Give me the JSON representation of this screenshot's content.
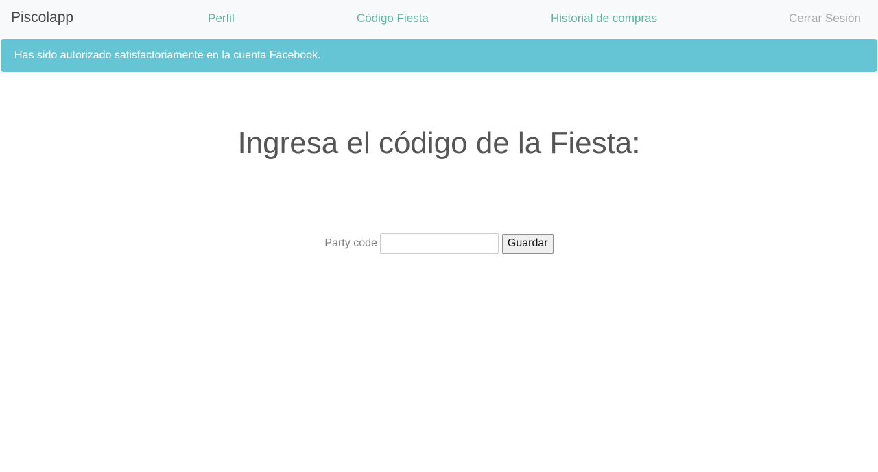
{
  "navbar": {
    "brand": "Piscolapp",
    "links": [
      {
        "label": "Perfil",
        "color": "#5cb89a"
      },
      {
        "label": "Código Fiesta",
        "color": "#5cb89a"
      },
      {
        "label": "Historial de compras",
        "color": "#5cb89a"
      },
      {
        "label": "Cerrar Sesión",
        "color": "#a8a8a8"
      }
    ],
    "background": "#f8f9fa"
  },
  "alert": {
    "message": "Has sido autorizado satisfactoriamente en la cuenta Facebook.",
    "background": "#66c5d4"
  },
  "main": {
    "heading": "Ingresa el código de la Fiesta:",
    "form": {
      "label": "Party code",
      "input_value": "",
      "input_placeholder": "",
      "submit_label": "Guardar"
    }
  }
}
